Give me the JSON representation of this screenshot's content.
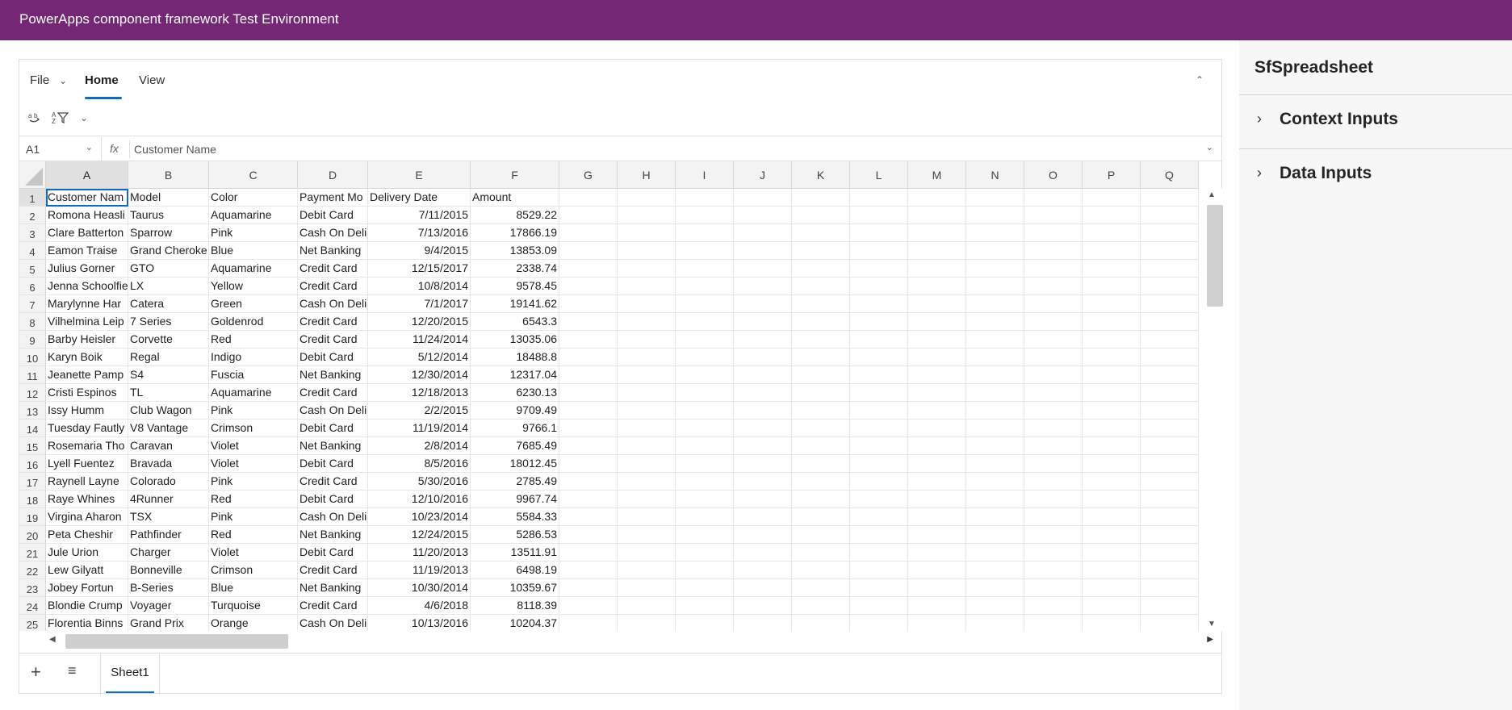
{
  "app": {
    "title": "PowerApps component framework Test Environment"
  },
  "ribbon": {
    "tabs": [
      {
        "label": "File"
      },
      {
        "label": "Home"
      },
      {
        "label": "View"
      }
    ]
  },
  "formula_bar": {
    "cell_ref": "A1",
    "fx_label": "fx",
    "value": "Customer Name"
  },
  "columns": [
    "A",
    "B",
    "C",
    "D",
    "E",
    "F",
    "G",
    "H",
    "I",
    "J",
    "K",
    "L",
    "M",
    "N",
    "O",
    "P",
    "Q"
  ],
  "rows": [
    [
      "Customer Nam",
      "Model",
      "Color",
      "Payment Mo",
      "Delivery Date",
      "Amount"
    ],
    [
      "Romona Heasli",
      "Taurus",
      "Aquamarine",
      "Debit Card",
      "7/11/2015",
      "8529.22"
    ],
    [
      "Clare Batterton",
      "Sparrow",
      "Pink",
      "Cash On Deli",
      "7/13/2016",
      "17866.19"
    ],
    [
      "Eamon Traise",
      "Grand Cheroke",
      "Blue",
      "Net Banking",
      "9/4/2015",
      "13853.09"
    ],
    [
      "Julius Gorner",
      "GTO",
      "Aquamarine",
      "Credit Card",
      "12/15/2017",
      "2338.74"
    ],
    [
      "Jenna Schoolfie",
      "LX",
      "Yellow",
      "Credit Card",
      "10/8/2014",
      "9578.45"
    ],
    [
      "Marylynne Har",
      "Catera",
      "Green",
      "Cash On Deli",
      "7/1/2017",
      "19141.62"
    ],
    [
      "Vilhelmina Leip",
      "7 Series",
      "Goldenrod",
      "Credit Card",
      "12/20/2015",
      "6543.3"
    ],
    [
      "Barby Heisler",
      "Corvette",
      "Red",
      "Credit Card",
      "11/24/2014",
      "13035.06"
    ],
    [
      "Karyn Boik",
      "Regal",
      "Indigo",
      "Debit Card",
      "5/12/2014",
      "18488.8"
    ],
    [
      "Jeanette Pamp",
      "S4",
      "Fuscia",
      "Net Banking",
      "12/30/2014",
      "12317.04"
    ],
    [
      "Cristi Espinos",
      "TL",
      "Aquamarine",
      "Credit Card",
      "12/18/2013",
      "6230.13"
    ],
    [
      "Issy Humm",
      "Club Wagon",
      "Pink",
      "Cash On Deli",
      "2/2/2015",
      "9709.49"
    ],
    [
      "Tuesday Fautly",
      "V8 Vantage",
      "Crimson",
      "Debit Card",
      "11/19/2014",
      "9766.1"
    ],
    [
      "Rosemaria Tho",
      "Caravan",
      "Violet",
      "Net Banking",
      "2/8/2014",
      "7685.49"
    ],
    [
      "Lyell Fuentez",
      "Bravada",
      "Violet",
      "Debit Card",
      "8/5/2016",
      "18012.45"
    ],
    [
      "Raynell Layne",
      "Colorado",
      "Pink",
      "Credit Card",
      "5/30/2016",
      "2785.49"
    ],
    [
      "Raye Whines",
      "4Runner",
      "Red",
      "Debit Card",
      "12/10/2016",
      "9967.74"
    ],
    [
      "Virgina Aharon",
      "TSX",
      "Pink",
      "Cash On Deli",
      "10/23/2014",
      "5584.33"
    ],
    [
      "Peta Cheshir",
      "Pathfinder",
      "Red",
      "Net Banking",
      "12/24/2015",
      "5286.53"
    ],
    [
      "Jule Urion",
      "Charger",
      "Violet",
      "Debit Card",
      "11/20/2013",
      "13511.91"
    ],
    [
      "Lew Gilyatt",
      "Bonneville",
      "Crimson",
      "Credit Card",
      "11/19/2013",
      "6498.19"
    ],
    [
      "Jobey Fortun",
      "B-Series",
      "Blue",
      "Net Banking",
      "10/30/2014",
      "10359.67"
    ],
    [
      "Blondie Crump",
      "Voyager",
      "Turquoise",
      "Credit Card",
      "4/6/2018",
      "8118.39"
    ],
    [
      "Florentia Binns",
      "Grand Prix",
      "Orange",
      "Cash On Deli",
      "10/13/2016",
      "10204.37"
    ]
  ],
  "row_numbers": [
    "1",
    "2",
    "3",
    "4",
    "5",
    "6",
    "7",
    "8",
    "9",
    "10",
    "11",
    "12",
    "13",
    "14",
    "15",
    "16",
    "17",
    "18",
    "19",
    "20",
    "21",
    "22",
    "23",
    "24",
    "25"
  ],
  "sheets": [
    {
      "label": "Sheet1"
    }
  ],
  "side_panel": {
    "title": "SfSpreadsheet",
    "sections": [
      {
        "label": "Context Inputs"
      },
      {
        "label": "Data Inputs"
      }
    ]
  },
  "colors": {
    "topbar": "#742774",
    "accent": "#0f6cbd"
  }
}
